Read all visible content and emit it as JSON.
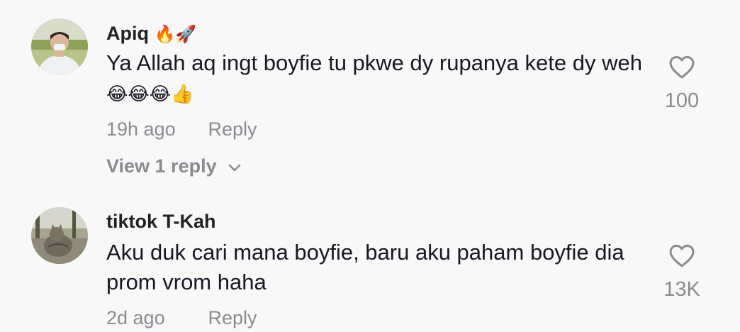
{
  "comments": [
    {
      "username": "Apiq",
      "username_emoji": "🔥🚀",
      "text": "Ya Allah aq ingt boyfie tu pkwe dy rupanya kete dy weh",
      "text_emoji": "😂😂😂👍",
      "time": "19h ago",
      "reply_label": "Reply",
      "view_replies_label": "View 1 reply",
      "likes": "100",
      "avatar_icon": "avatar-photo-person"
    },
    {
      "username": "tiktok T-Kah",
      "text": "Aku duk cari mana boyfie, baru aku paham boyfie dia prom vrom haha",
      "time": "2d ago",
      "reply_label": "Reply",
      "likes": "13K",
      "avatar_icon": "avatar-photo-cat"
    }
  ],
  "colors": {
    "background": "#f8f8f8",
    "primary_text": "#161823",
    "secondary_text": "#8a8b91"
  }
}
